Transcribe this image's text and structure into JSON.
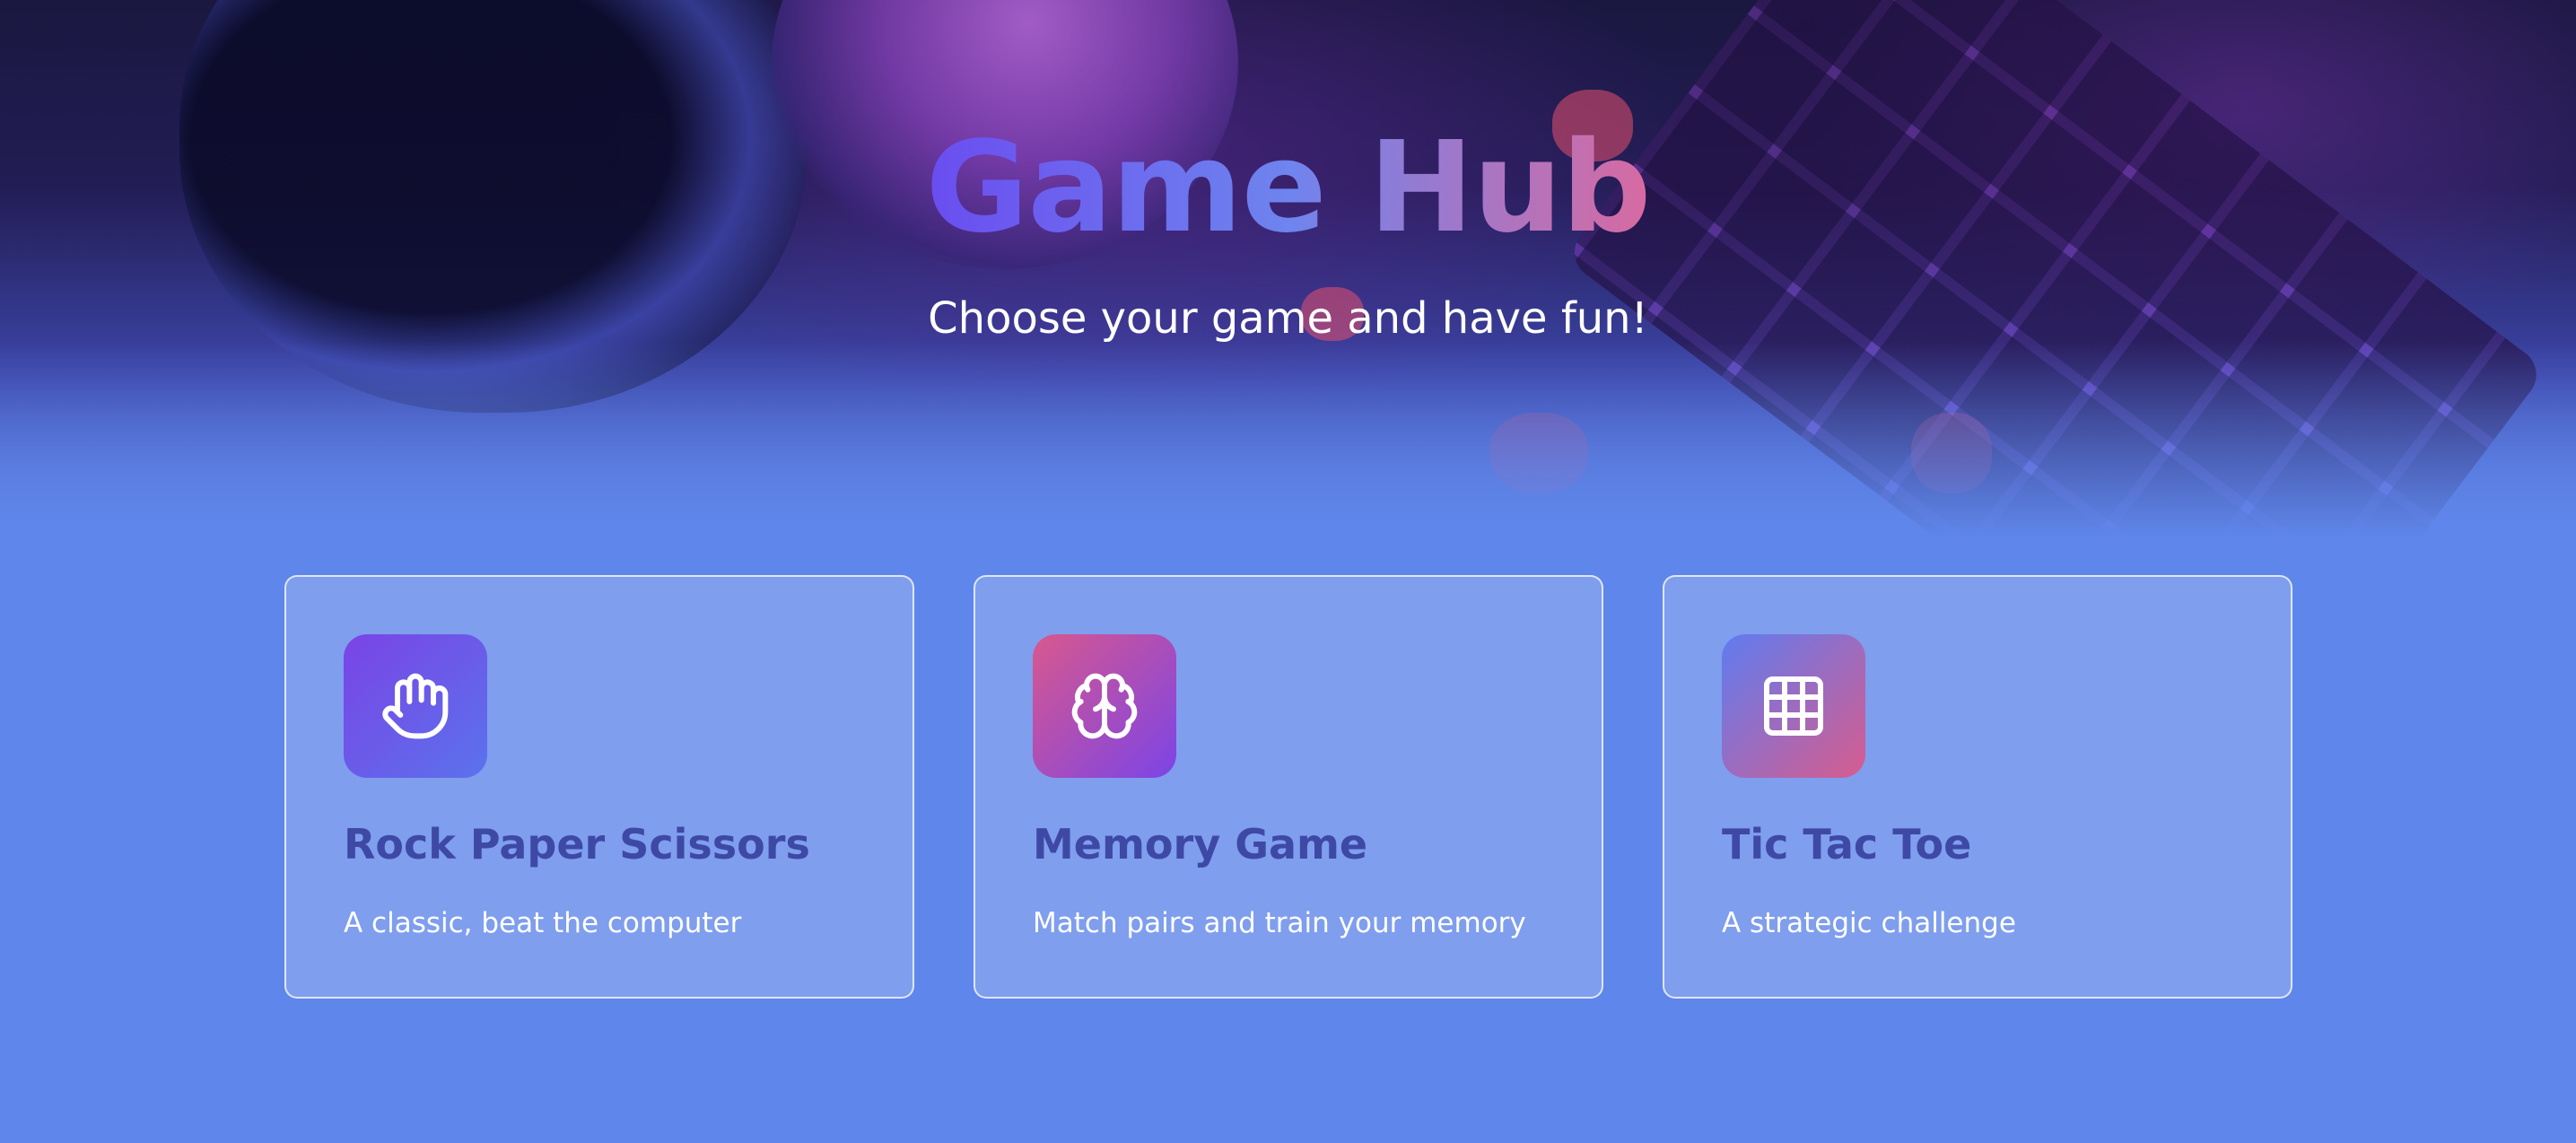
{
  "header": {
    "title": "Game Hub",
    "subtitle": "Choose your game and have fun!"
  },
  "cards": [
    {
      "title": "Rock Paper Scissors",
      "description": "A classic, beat the computer",
      "icon": "hand-icon"
    },
    {
      "title": "Memory Game",
      "description": "Match pairs and train your memory",
      "icon": "brain-icon"
    },
    {
      "title": "Tic Tac Toe",
      "description": "A strategic challenge",
      "icon": "grid-icon"
    }
  ],
  "colors": {
    "page_background": "#5f86ea",
    "card_title": "#3e49a5",
    "title_gradient_start": "#6a4df0",
    "title_gradient_end": "#d86aa0"
  }
}
